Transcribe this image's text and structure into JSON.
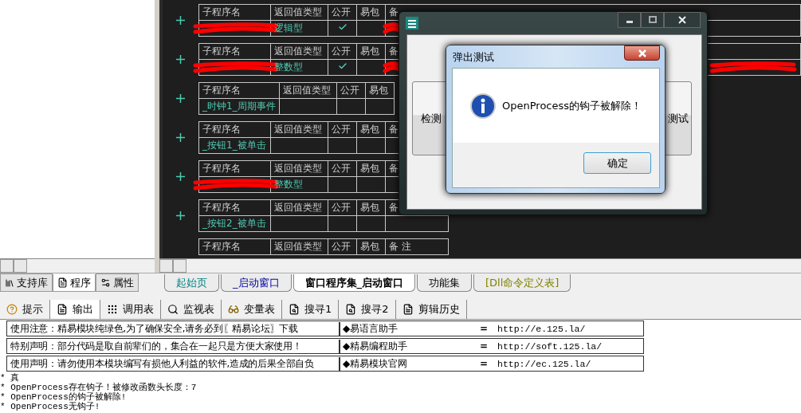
{
  "code_tables": [
    {
      "columns": [
        "子程序名",
        "返回值类型",
        "公开",
        "易包",
        "备"
      ],
      "row": {
        "return_type": "逻辑型",
        "public": true,
        "name_redacted": true,
        "remark_redacted": true,
        "far_redacted": false
      },
      "wide": true
    },
    {
      "columns": [
        "子程序名",
        "返回值类型",
        "公开",
        "易包",
        "备"
      ],
      "row": {
        "return_type": "整数型",
        "public": true,
        "name_redacted": true,
        "remark_redacted": true,
        "far_redacted": true
      },
      "wide": true
    },
    {
      "columns": [
        "子程序名",
        "返回值类型",
        "公开",
        "易包"
      ],
      "row": {
        "name": "_时钟1_周期事件",
        "public": false,
        "name_redacted": false
      },
      "wide": false
    },
    {
      "columns": [
        "子程序名",
        "返回值类型",
        "公开",
        "易包",
        "备"
      ],
      "row": {
        "name": "_按钮1_被单击",
        "public": false,
        "name_redacted": false,
        "remark_redacted": false
      },
      "wide": false
    },
    {
      "columns": [
        "子程序名",
        "返回值类型",
        "公开",
        "易包",
        "备"
      ],
      "row": {
        "return_type": "整数型",
        "public": false,
        "name_redacted": true,
        "remark_redacted": false
      },
      "wide": false
    },
    {
      "columns": [
        "子程序名",
        "返回值类型",
        "公开",
        "易包",
        "备"
      ],
      "row": {
        "name": "_按钮2_被单击",
        "public": false,
        "name_redacted": false,
        "remark_redacted": false
      },
      "wide": false
    },
    {
      "columns": [
        "子程序名",
        "返回值类型",
        "公开",
        "易包",
        "备 注"
      ],
      "wide": false
    }
  ],
  "sidebar_tabs": [
    {
      "label": "支持库",
      "kind": "library",
      "selected": false
    },
    {
      "label": "程序",
      "kind": "program",
      "selected": true
    },
    {
      "label": "属性",
      "kind": "property",
      "selected": false
    }
  ],
  "editor_tabs": [
    {
      "label": "起始页",
      "kind": "start",
      "selected": false
    },
    {
      "label": "_启动窗口",
      "kind": "window",
      "selected": false
    },
    {
      "label": "窗口程序集_启动窗口",
      "kind": "code",
      "selected": true
    },
    {
      "label": "功能集",
      "kind": "code",
      "selected": false
    },
    {
      "label": "[Dll命令定义表]",
      "kind": "dll",
      "selected": false
    }
  ],
  "tool_tabs": [
    {
      "label": "提示",
      "kind": "hint",
      "selected": false
    },
    {
      "label": "输出",
      "kind": "output",
      "selected": true
    },
    {
      "label": "调用表",
      "kind": "calls",
      "selected": false
    },
    {
      "label": "监视表",
      "kind": "watch",
      "selected": false
    },
    {
      "label": "变量表",
      "kind": "vars",
      "selected": false
    },
    {
      "label": "搜寻1",
      "kind": "search",
      "selected": false
    },
    {
      "label": "搜寻2",
      "kind": "search",
      "selected": false
    },
    {
      "label": "剪辑历史",
      "kind": "clip",
      "selected": false
    }
  ],
  "output": {
    "notices": [
      {
        "text": "使用注意：精易模块纯绿色,为了确保安全,请务必到〖精易论坛〗下载",
        "link_label": "◆易语言助手",
        "equals": "=",
        "url": "http://e.125.la/"
      },
      {
        "text": "特别声明：部分代码是取自前辈们的，集合在一起只是方便大家使用！",
        "link_label": "◆精易编程助手",
        "equals": "=",
        "url": "http://soft.125.la/"
      },
      {
        "text": "使用声明：请勿使用本模块编写有损他人利益的软件,造成的后果全部自负",
        "link_label": "◆精易模块官网",
        "equals": "=",
        "url": "http://ec.125.la/"
      }
    ],
    "log": [
      "* 真",
      "* OpenProcess存在钩子！被修改函数头长度：7",
      "* OpenProcess的钩子被解除!",
      "* OpenProcess无钩子!"
    ]
  },
  "app_window": {
    "buttons": [
      "检测",
      "测试"
    ]
  },
  "message_box": {
    "title": "弹出测试",
    "message": "OpenProcess的钩子被解除！",
    "ok": "确定"
  }
}
